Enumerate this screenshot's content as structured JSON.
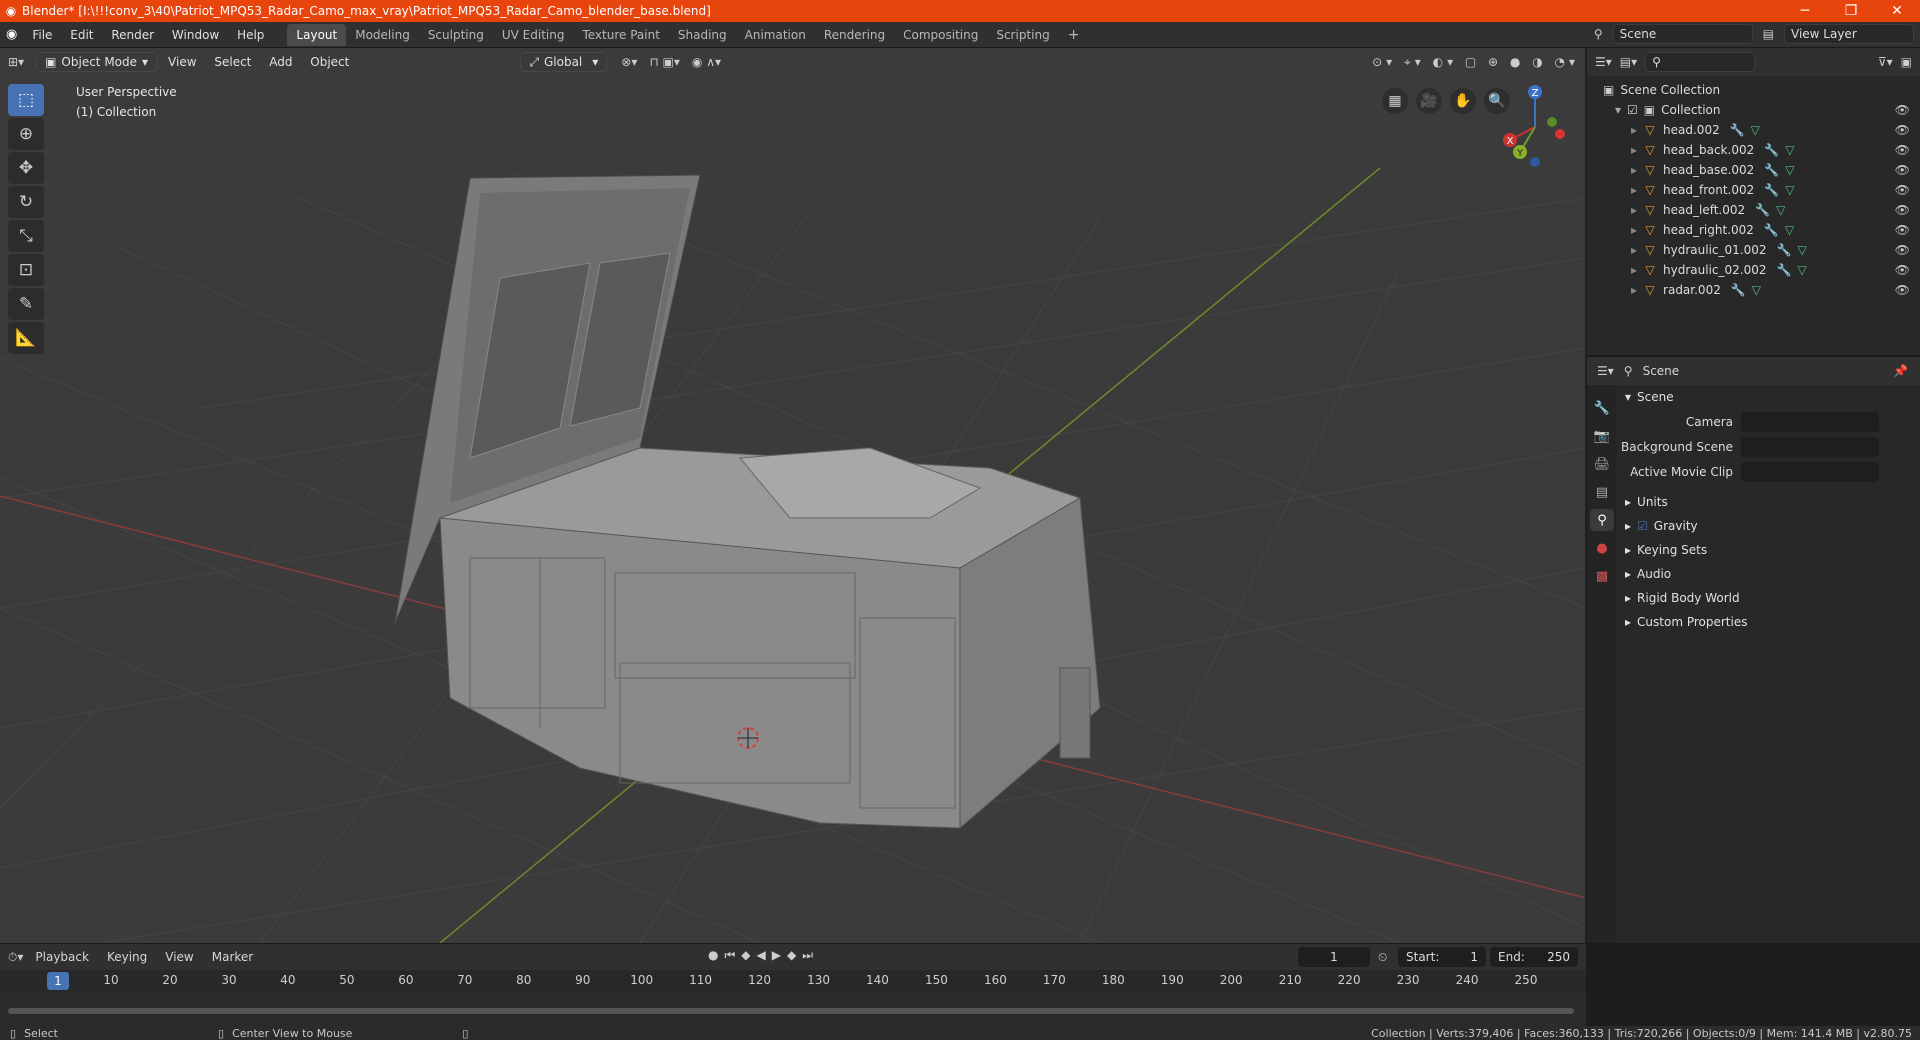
{
  "window": {
    "title": "Blender* [I:\\!!!conv_3\\40\\Patriot_MPQ53_Radar_Camo_max_vray\\Patriot_MPQ53_Radar_Camo_blender_base.blend]",
    "minimize": "─",
    "maximize": "❐",
    "close": "✕"
  },
  "menu": [
    "File",
    "Edit",
    "Render",
    "Window",
    "Help"
  ],
  "workspaces": [
    "Layout",
    "Modeling",
    "Sculpting",
    "UV Editing",
    "Texture Paint",
    "Shading",
    "Animation",
    "Rendering",
    "Compositing",
    "Scripting"
  ],
  "scene_field": "Scene",
  "view_layer_field": "View Layer",
  "viewport": {
    "mode": "Object Mode",
    "menus": [
      "View",
      "Select",
      "Add",
      "Object"
    ],
    "orientation": "Global",
    "perspective": "User Perspective",
    "collection": "(1) Collection"
  },
  "gizmo": {
    "x": "X",
    "y": "Y",
    "z": "Z"
  },
  "outliner": {
    "root": "Scene Collection",
    "collection": "Collection",
    "items": [
      "head.002",
      "head_back.002",
      "head_base.002",
      "head_front.002",
      "head_left.002",
      "head_right.002",
      "hydraulic_01.002",
      "hydraulic_02.002",
      "radar.002"
    ]
  },
  "properties": {
    "header": "Scene",
    "section": "Scene",
    "fields": [
      {
        "label": "Camera",
        "value": ""
      },
      {
        "label": "Background Scene",
        "value": ""
      },
      {
        "label": "Active Movie Clip",
        "value": ""
      }
    ],
    "panels": [
      "Units",
      "Gravity",
      "Keying Sets",
      "Audio",
      "Rigid Body World",
      "Custom Properties"
    ]
  },
  "timeline": {
    "menus": [
      "Playback",
      "Keying",
      "View",
      "Marker"
    ],
    "current_frame": "1",
    "start_label": "Start:",
    "start": "1",
    "end_label": "End:",
    "end": "250",
    "ticks": [
      "1",
      "10",
      "20",
      "30",
      "40",
      "50",
      "60",
      "70",
      "80",
      "90",
      "100",
      "110",
      "120",
      "130",
      "140",
      "150",
      "160",
      "170",
      "180",
      "190",
      "200",
      "210",
      "220",
      "230",
      "240",
      "250"
    ]
  },
  "statusbar": {
    "left": "Select",
    "middle": "Center View to Mouse",
    "right": "Collection | Verts:379,406 | Faces:360,133 | Tris:720,266 | Objects:0/9 | Mem: 141.4 MB | v2.80.75"
  },
  "colors": {
    "accent": "#4772b3",
    "title_bar": "#e8440e",
    "mesh_icon": "#e8963a"
  }
}
